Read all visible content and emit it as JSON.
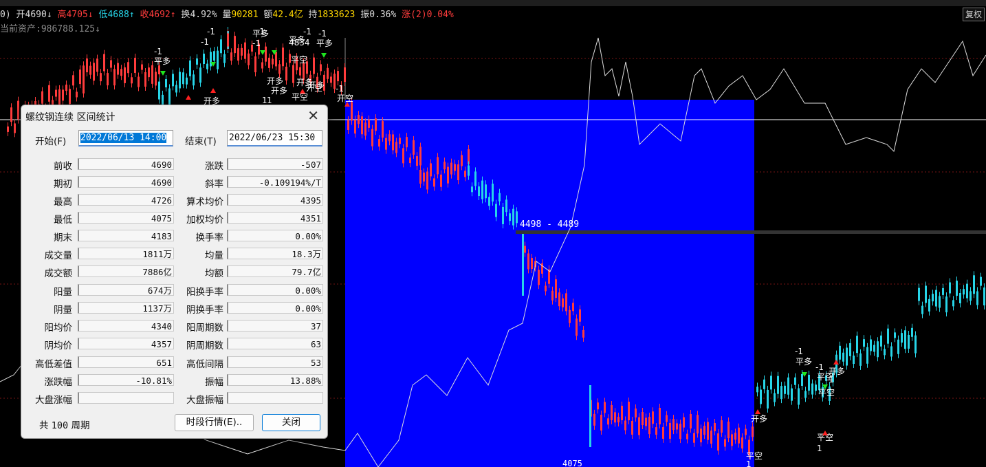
{
  "colors": {
    "up": "#ff3c3c",
    "down": "#27d5e8",
    "select": "#0000ff",
    "text_dim": "#8a8a8a"
  },
  "header": {
    "prefix": "0)",
    "open_label": "开",
    "open": "4690",
    "open_arrow": "↓",
    "high_label": "高",
    "high": "4705",
    "high_arrow": "↓",
    "low_label": "低",
    "low": "4688",
    "low_arrow": "↑",
    "close_label": "收",
    "close": "4692",
    "close_arrow": "↑",
    "turnover_label": "换",
    "turnover": "4.92%",
    "volume_label": "量",
    "volume": "90281",
    "amount_label": "额",
    "amount": "42.4亿",
    "hold_label": "持",
    "hold": "1833623",
    "amplitude_label": "振",
    "amplitude": "0.36%",
    "change_label": "涨(2)",
    "change": "0.04%",
    "fq_button": "复权"
  },
  "asset_text": "当前资产:986788.125↓",
  "chart_labels": {
    "range": "4498 - 4489",
    "low_marker": "4075",
    "signals": [
      {
        "text": "-1"
      },
      {
        "text": "平多"
      },
      {
        "text": "-1"
      },
      {
        "text": "平多"
      },
      {
        "text": "-1"
      },
      {
        "text": "平多"
      },
      {
        "text": "-1"
      },
      {
        "text": "平多"
      },
      {
        "text": "开多"
      },
      {
        "text": "开多"
      },
      {
        "text": "开多"
      },
      {
        "text": "4834"
      },
      {
        "text": "平空"
      },
      {
        "text": "开多"
      },
      {
        "text": "开空"
      },
      {
        "text": "开多"
      },
      {
        "text": "平空"
      },
      {
        "text": "-1"
      },
      {
        "text": "开空"
      },
      {
        "text": "开多"
      },
      {
        "text": "平空"
      },
      {
        "text": "-1"
      },
      {
        "text": "平多"
      },
      {
        "text": "-1"
      },
      {
        "text": "平空"
      },
      {
        "text": "开多"
      },
      {
        "text": "平空"
      },
      {
        "text": "1"
      },
      {
        "text": "1"
      },
      {
        "text": "1"
      },
      {
        "text": "-1"
      },
      {
        "text": "-1"
      },
      {
        "text": "1"
      },
      {
        "text": "-1"
      },
      {
        "text": "平空"
      },
      {
        "text": "1"
      }
    ]
  },
  "dialog": {
    "title": "螺纹钢连续 区间统计",
    "start_label": "开始(F)",
    "start_value": "2022/06/13 14:00",
    "end_label": "结束(T)",
    "end_value": "2022/06/23 15:30",
    "rows": [
      {
        "l1": "前收",
        "v1": "4690",
        "l2": "涨跌",
        "v2": "-507"
      },
      {
        "l1": "期初",
        "v1": "4690",
        "l2": "斜率",
        "v2": "-0.109194%/T"
      },
      {
        "l1": "最高",
        "v1": "4726",
        "l2": "算术均价",
        "v2": "4395"
      },
      {
        "l1": "最低",
        "v1": "4075",
        "l2": "加权均价",
        "v2": "4351"
      },
      {
        "l1": "期末",
        "v1": "4183",
        "l2": "换手率",
        "v2": "0.00%"
      },
      {
        "l1": "成交量",
        "v1": "1811万",
        "l2": "均量",
        "v2": "18.3万"
      },
      {
        "l1": "成交额",
        "v1": "7886亿",
        "l2": "均额",
        "v2": "79.7亿"
      },
      {
        "l1": "阳量",
        "v1": "674万",
        "l2": "阳换手率",
        "v2": "0.00%"
      },
      {
        "l1": "阴量",
        "v1": "1137万",
        "l2": "阴换手率",
        "v2": "0.00%"
      },
      {
        "l1": "阳均价",
        "v1": "4340",
        "l2": "阳周期数",
        "v2": "37"
      },
      {
        "l1": "阴均价",
        "v1": "4357",
        "l2": "阴周期数",
        "v2": "63"
      },
      {
        "l1": "高低差值",
        "v1": "651",
        "l2": "高低间隔",
        "v2": "53"
      },
      {
        "l1": "涨跌幅",
        "v1": "-10.81%",
        "l2": "振幅",
        "v2": "13.88%"
      },
      {
        "l1": "大盘涨幅",
        "v1": "",
        "l2": "大盘振幅",
        "v2": ""
      }
    ],
    "period_prefix": "共",
    "period_count": "100",
    "period_suffix": "周期",
    "segment_button": "时段行情(E)..",
    "close_button": "关闭"
  }
}
